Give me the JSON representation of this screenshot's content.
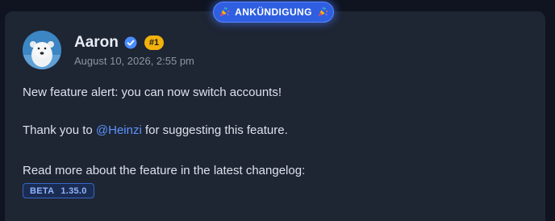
{
  "announcement": {
    "label": "ANKÜNDIGUNG",
    "icon_left": "party-popper-icon",
    "icon_right": "party-popper-icon",
    "accent_color": "#2f5fe0"
  },
  "post": {
    "author": "Aaron",
    "verified_icon": "verified-check-icon",
    "rank_badge": "#1",
    "timestamp": "August 10, 2026, 2:55 pm",
    "line1": "New feature alert: you can now switch accounts!",
    "line2_prefix": "Thank you to ",
    "mention": "@Heinzi",
    "line2_suffix": " for suggesting this feature.",
    "line3": "Read more about the feature in the latest changelog:",
    "version_badge": {
      "tag": "BETA",
      "version": "1.35.0"
    }
  },
  "colors": {
    "background": "#0f1420",
    "card": "#1e2533",
    "mention": "#5b95ff",
    "rank_badge": "#f2b20c"
  }
}
